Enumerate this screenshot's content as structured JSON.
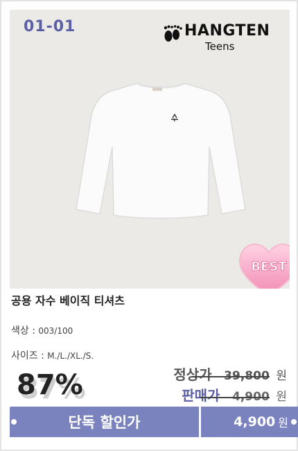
{
  "product": {
    "code": "01-01",
    "brand": "HANGTEN",
    "brand_sub": "Teens",
    "badge": "BEST",
    "title": "공용 자수 베이직 티셔츠",
    "color_label": "색상 :",
    "color_value": "003/100",
    "size_label": "사이즈 :",
    "size_value": "M./L./XL./S."
  },
  "pricing": {
    "discount": "87%",
    "regular_label": "정상가",
    "regular_price": "39,800",
    "sale_label": "판매가",
    "sale_price": "4,900",
    "currency": "원"
  },
  "cta": {
    "label": "단독 할인가",
    "price": "4,900",
    "currency": "원"
  },
  "colors": {
    "accent": "#7b83bf",
    "code_color": "#5a5fa6",
    "background": "#ebeae6",
    "badge_pink": "#f6a9c5"
  },
  "icons": {
    "logo": "footprint-logo-icon",
    "badge": "heart-best-badge"
  }
}
